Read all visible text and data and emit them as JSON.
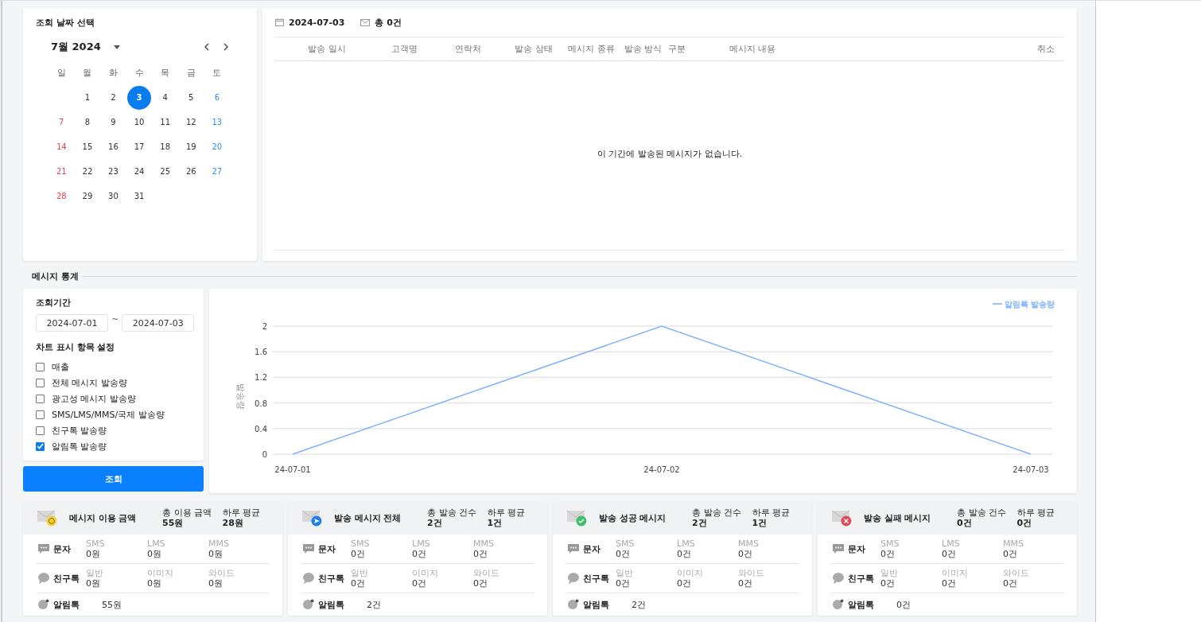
{
  "calendar": {
    "title": "조회 날짜 선택",
    "month_label": "7월 2024",
    "weekdays": [
      "일",
      "월",
      "화",
      "수",
      "목",
      "금",
      "토"
    ],
    "weeks": [
      [
        {
          "day": "1",
          "kind": "weekday",
          "selected": false
        },
        {
          "day": "2",
          "kind": "weekday",
          "selected": false
        },
        {
          "day": "3",
          "kind": "weekday",
          "selected": true
        },
        {
          "day": "4",
          "kind": "weekday",
          "selected": false
        },
        {
          "day": "5",
          "kind": "weekday",
          "selected": false
        },
        {
          "day": "6",
          "kind": "saturday",
          "selected": false
        }
      ],
      [
        {
          "day": "7",
          "kind": "sunday",
          "selected": false
        },
        {
          "day": "8",
          "kind": "weekday",
          "selected": false
        },
        {
          "day": "9",
          "kind": "weekday",
          "selected": false
        },
        {
          "day": "10",
          "kind": "weekday",
          "selected": false
        },
        {
          "day": "11",
          "kind": "weekday",
          "selected": false
        },
        {
          "day": "12",
          "kind": "weekday",
          "selected": false
        },
        {
          "day": "13",
          "kind": "saturday",
          "selected": false
        }
      ],
      [
        {
          "day": "14",
          "kind": "sunday",
          "selected": false
        },
        {
          "day": "15",
          "kind": "weekday",
          "selected": false
        },
        {
          "day": "16",
          "kind": "weekday",
          "selected": false
        },
        {
          "day": "17",
          "kind": "weekday",
          "selected": false
        },
        {
          "day": "18",
          "kind": "weekday",
          "selected": false
        },
        {
          "day": "19",
          "kind": "weekday",
          "selected": false
        },
        {
          "day": "20",
          "kind": "saturday",
          "selected": false
        }
      ],
      [
        {
          "day": "21",
          "kind": "sunday",
          "selected": false
        },
        {
          "day": "22",
          "kind": "weekday",
          "selected": false
        },
        {
          "day": "23",
          "kind": "weekday",
          "selected": false
        },
        {
          "day": "24",
          "kind": "weekday",
          "selected": false
        },
        {
          "day": "25",
          "kind": "weekday",
          "selected": false
        },
        {
          "day": "26",
          "kind": "weekday",
          "selected": false
        },
        {
          "day": "27",
          "kind": "saturday",
          "selected": false
        }
      ],
      [
        {
          "day": "28",
          "kind": "sunday",
          "selected": false
        },
        {
          "day": "29",
          "kind": "weekday",
          "selected": false
        },
        {
          "day": "30",
          "kind": "weekday",
          "selected": false
        },
        {
          "day": "31",
          "kind": "weekday",
          "selected": false
        }
      ]
    ]
  },
  "messages": {
    "date": "2024-07-03",
    "total": "총 0건",
    "columns": [
      "발송 일시",
      "고객명",
      "연락처",
      "발송 상태",
      "메시지 종류",
      "발송 방식",
      "구분",
      "메시지 내용",
      "취소"
    ],
    "empty_text": "이 기간에 발송된 메시지가 없습니다."
  },
  "stats_title": "메시지 통계",
  "filter": {
    "period_label": "조회기간",
    "start": "2024-07-01",
    "separator": "~",
    "end": "2024-07-03",
    "items_label": "차트 표시 항목 설정",
    "items": [
      {
        "label": "매출",
        "checked": false
      },
      {
        "label": "전체 메시지 발송량",
        "checked": false
      },
      {
        "label": "광고성 메시지 발송량",
        "checked": false
      },
      {
        "label": "SMS/LMS/MMS/국제 발송량",
        "checked": false
      },
      {
        "label": "친구톡 발송량",
        "checked": false
      },
      {
        "label": "알림톡 발송량",
        "checked": true
      }
    ],
    "button": "조회"
  },
  "chart": {
    "chart_data": {
      "type": "line",
      "grid": true,
      "ylabel": "발송량",
      "categories": [
        "24-07-01",
        "24-07-02",
        "24-07-03"
      ],
      "ylim": [
        0,
        2
      ],
      "yticks": [
        0,
        0.4,
        0.8,
        1.2,
        1.6,
        2
      ],
      "series": [
        {
          "name": "알림톡 발송량",
          "color": "#80b1ff",
          "values": [
            0,
            2,
            0
          ]
        }
      ]
    }
  },
  "cards": [
    {
      "kind": "cost",
      "title": "메시지 이용 금액",
      "summary": [
        {
          "label": "총 이용 금액",
          "value": "55원"
        },
        {
          "label": "하루 평균",
          "value": "28원"
        }
      ],
      "rows": [
        {
          "kind": "text",
          "label": "문자",
          "cells": [
            {
              "label": "SMS",
              "value": "0원"
            },
            {
              "label": "LMS",
              "value": "0원"
            },
            {
              "label": "MMS",
              "value": "0원"
            }
          ]
        },
        {
          "kind": "friend",
          "label": "친구톡",
          "cells": [
            {
              "label": "일반",
              "value": "0원"
            },
            {
              "label": "이미지",
              "value": "0원"
            },
            {
              "label": "와이드",
              "value": "0원"
            }
          ]
        },
        {
          "kind": "alim",
          "label": "알림톡",
          "cells": [
            {
              "value": "55원"
            }
          ]
        }
      ]
    },
    {
      "kind": "sent",
      "title": "발송 메시지 전체",
      "summary": [
        {
          "label": "총 발송 건수",
          "value": "2건"
        },
        {
          "label": "하루 평균",
          "value": "1건"
        }
      ],
      "rows": [
        {
          "kind": "text",
          "label": "문자",
          "cells": [
            {
              "label": "SMS",
              "value": "0건"
            },
            {
              "label": "LMS",
              "value": "0건"
            },
            {
              "label": "MMS",
              "value": "0건"
            }
          ]
        },
        {
          "kind": "friend",
          "label": "친구톡",
          "cells": [
            {
              "label": "일반",
              "value": "0건"
            },
            {
              "label": "이미지",
              "value": "0건"
            },
            {
              "label": "와이드",
              "value": "0건"
            }
          ]
        },
        {
          "kind": "alim",
          "label": "알림톡",
          "cells": [
            {
              "value": "2건"
            }
          ]
        }
      ]
    },
    {
      "kind": "success",
      "title": "발송 성공 메시지",
      "summary": [
        {
          "label": "총 발송 건수",
          "value": "2건"
        },
        {
          "label": "하루 평균",
          "value": "1건"
        }
      ],
      "rows": [
        {
          "kind": "text",
          "label": "문자",
          "cells": [
            {
              "label": "SMS",
              "value": "0건"
            },
            {
              "label": "LMS",
              "value": "0건"
            },
            {
              "label": "MMS",
              "value": "0건"
            }
          ]
        },
        {
          "kind": "friend",
          "label": "친구톡",
          "cells": [
            {
              "label": "일반",
              "value": "0건"
            },
            {
              "label": "이미지",
              "value": "0건"
            },
            {
              "label": "와이드",
              "value": "0건"
            }
          ]
        },
        {
          "kind": "alim",
          "label": "알림톡",
          "cells": [
            {
              "value": "2건"
            }
          ]
        }
      ]
    },
    {
      "kind": "fail",
      "title": "발송 실패 메시지",
      "summary": [
        {
          "label": "총 발송 건수",
          "value": "0건"
        },
        {
          "label": "하루 평균",
          "value": "0건"
        }
      ],
      "rows": [
        {
          "kind": "text",
          "label": "문자",
          "cells": [
            {
              "label": "SMS",
              "value": "0건"
            },
            {
              "label": "LMS",
              "value": "0건"
            },
            {
              "label": "MMS",
              "value": "0건"
            }
          ]
        },
        {
          "kind": "friend",
          "label": "친구톡",
          "cells": [
            {
              "label": "일반",
              "value": "0건"
            },
            {
              "label": "이미지",
              "value": "0건"
            },
            {
              "label": "와이드",
              "value": "0건"
            }
          ]
        },
        {
          "kind": "alim",
          "label": "알림톡",
          "cells": [
            {
              "value": "0건"
            }
          ]
        }
      ]
    }
  ]
}
